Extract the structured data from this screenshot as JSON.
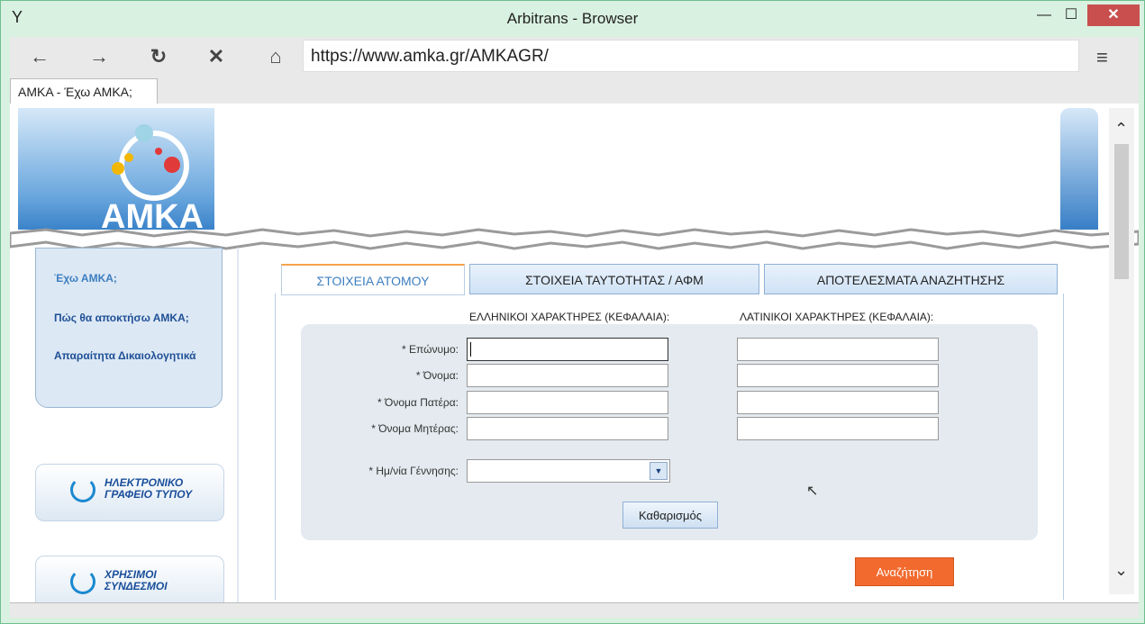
{
  "window": {
    "title": "Arbitrans - Browser",
    "minimize": "—",
    "maximize": "☐",
    "close": "✕"
  },
  "toolbar": {
    "back": "←",
    "forward": "→",
    "reload": "↻",
    "stop": "✕",
    "home": "⌂",
    "url": "https://www.amka.gr/AMKAGR/",
    "menu": "≡"
  },
  "tab": {
    "label": "ΑΜΚΑ - Έχω ΑΜΚΑ;"
  },
  "logo": {
    "text": "ΑΜΚΑ"
  },
  "sidebar": {
    "links": [
      "Έχω ΑΜΚΑ;",
      "Πώς θα αποκτήσω ΑΜΚΑ;",
      "Απαραίτητα Δικαιολογητικά"
    ],
    "tiles": [
      {
        "text": "ΗΛΕΚΤΡΟΝΙΚΟ ΓΡΑΦΕΙΟ ΤΥΠΟΥ"
      },
      {
        "text": "ΧΡΗΣΙΜΟΙ ΣΥΝΔΕΣΜΟΙ"
      }
    ]
  },
  "form": {
    "tabs": [
      {
        "label": "ΣΤΟΙΧΕΙΑ ΑΤΟΜΟΥ",
        "active": true
      },
      {
        "label": "ΣΤΟΙΧΕΙΑ ΤΑΥΤΟΤΗΤΑΣ / ΑΦΜ",
        "active": false
      },
      {
        "label": "ΑΠΟΤΕΛΕΣΜΑΤΑ ΑΝΑΖΗΤΗΣΗΣ",
        "active": false
      }
    ],
    "greek_header": "ΕΛΛΗΝΙΚΟΙ ΧΑΡΑΚΤΗΡΕΣ (ΚΕΦΑΛΑΙΑ):",
    "latin_header": "ΛΑΤΙΝΙΚΟΙ ΧΑΡΑΚΤΗΡΕΣ (ΚΕΦΑΛΑΙΑ):",
    "fields": [
      {
        "label": "* Επώνυμο:",
        "greek_value": "",
        "latin_value": ""
      },
      {
        "label": "* Όνομα:",
        "greek_value": "",
        "latin_value": ""
      },
      {
        "label": "* Όνομα Πατέρα:",
        "greek_value": "",
        "latin_value": ""
      },
      {
        "label": "* Όνομα Μητέρας:",
        "greek_value": "",
        "latin_value": ""
      }
    ],
    "dob_label": "* Ημ/νία Γέννησης:",
    "dob_value": "",
    "clear_button": "Καθαρισμός",
    "search_button": "Αναζήτηση"
  },
  "colors": {
    "accent": "#1a6bbd",
    "search": "#f26a2e",
    "close": "#c94f4f"
  }
}
